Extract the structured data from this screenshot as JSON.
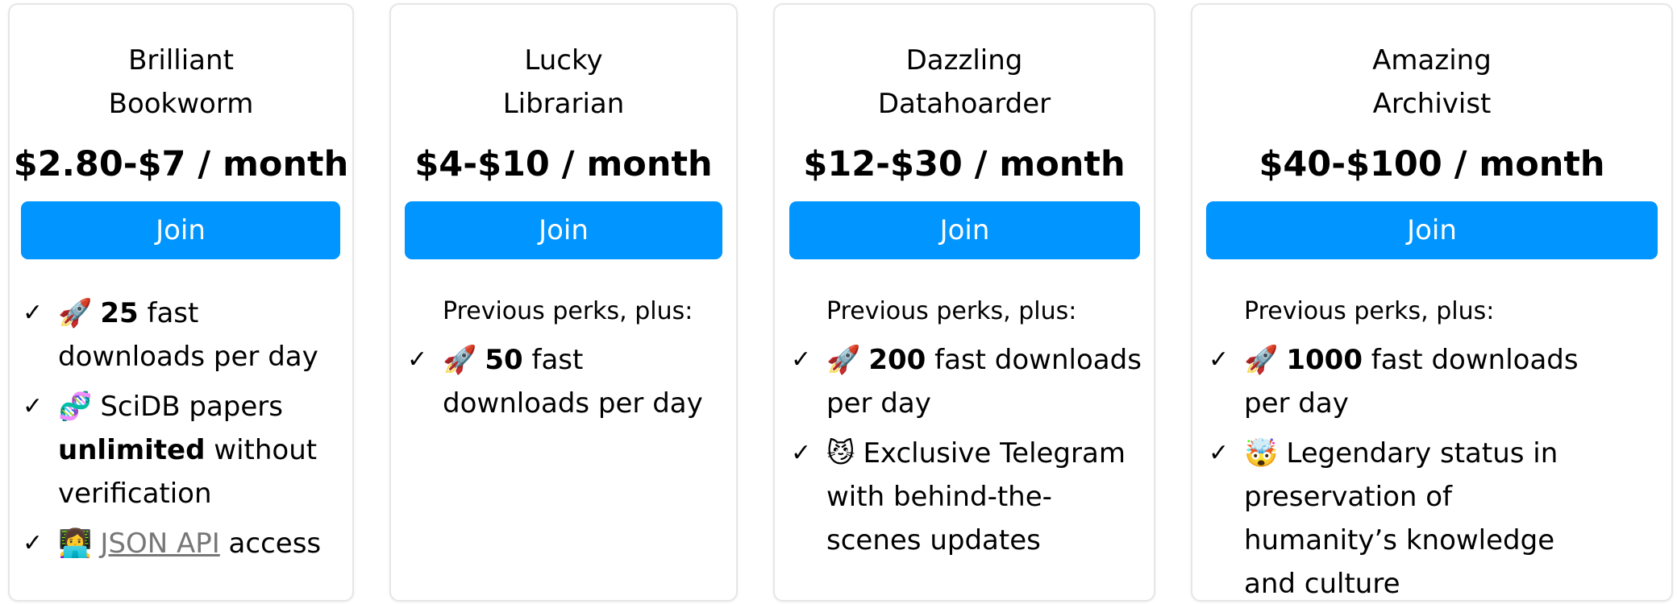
{
  "tiers": [
    {
      "name_line1": "Brilliant",
      "name_line2": "Bookworm",
      "price": "$2.80-$7 / month",
      "join_label": "Join",
      "perk1": {
        "icon": "🚀",
        "bold": "25",
        "text": " fast downloads per day"
      },
      "perk2": {
        "icon": "🧬",
        "text_pre": "SciDB papers ",
        "bold": "unlimited",
        "text_post": " without verification"
      },
      "perk3": {
        "icon": "👩‍💻",
        "link": "JSON API",
        "text": " access"
      }
    },
    {
      "name_line1": "Lucky",
      "name_line2": "Librarian",
      "price": "$4-$10 / month",
      "join_label": "Join",
      "note": "Previous perks, plus:",
      "perk1": {
        "icon": "🚀",
        "bold": "50",
        "text": " fast downloads per day"
      }
    },
    {
      "name_line1": "Dazzling",
      "name_line2": "Datahoarder",
      "price": "$12-$30 / month",
      "join_label": "Join",
      "note": "Previous perks, plus:",
      "perk1": {
        "icon": "🚀",
        "bold": "200",
        "text": " fast downloads per day"
      },
      "perk2": {
        "icon": "😼",
        "text": "Exclusive Telegram with behind-the-scenes updates"
      }
    },
    {
      "name_line1": "Amazing",
      "name_line2": "Archivist",
      "price": "$40-$100 / month",
      "join_label": "Join",
      "note": "Previous perks, plus:",
      "perk1": {
        "icon": "🚀",
        "bold": "1000",
        "text": " fast downloads per day"
      },
      "perk2": {
        "icon": "🤯",
        "text": "Legendary status in preservation of humanity’s knowledge and culture"
      }
    }
  ],
  "check_mark": "✓",
  "colors": {
    "join_button": "#0095ff",
    "card_border": "#e6e6e6",
    "link": "#777777"
  }
}
